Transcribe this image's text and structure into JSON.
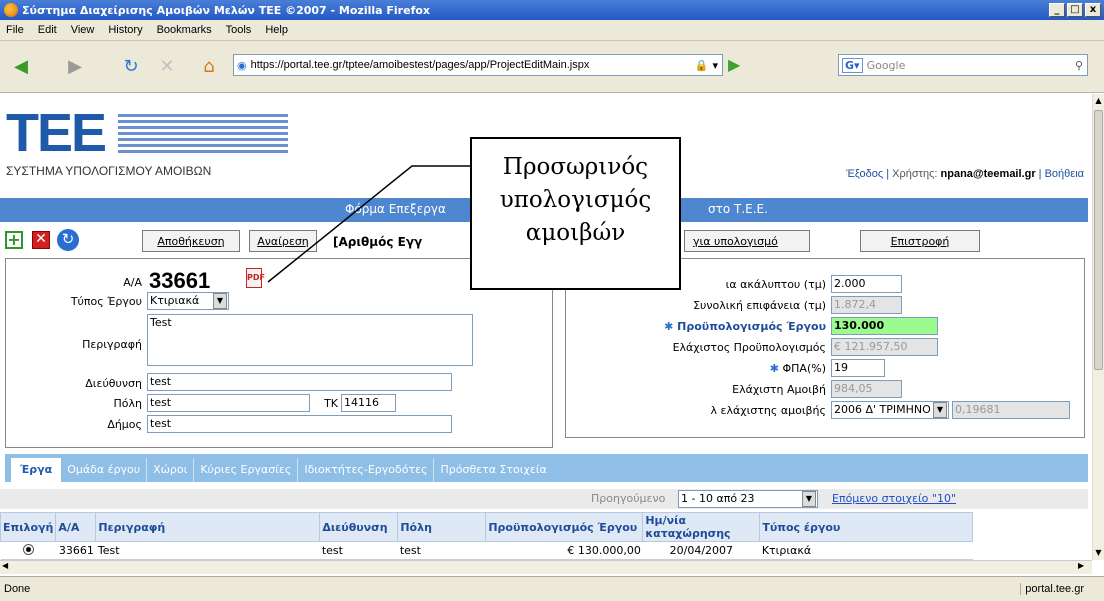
{
  "window": {
    "title": "Σύστημα Διαχείρισης Αμοιβών Μελών ΤΕΕ ©2007 - Mozilla Firefox"
  },
  "menu": [
    "File",
    "Edit",
    "View",
    "History",
    "Bookmarks",
    "Tools",
    "Help"
  ],
  "browser": {
    "url": "https://portal.tee.gr/tptee/amoibestest/pages/app/ProjectEditMain.jspx",
    "search_placeholder": "Google",
    "status": "Done",
    "status_domain": "portal.tee.gr"
  },
  "header": {
    "logo": "ΤΕΕ",
    "system_name": "ΣΥΣΤΗΜΑ ΥΠΟΛΟΓΙΣΜΟΥ ΑΜΟΙΒΩΝ",
    "logout": "Έξοδος",
    "user_label": "Χρήστης:",
    "user": "npana@teemail.gr",
    "help": "Βοήθεια"
  },
  "form": {
    "bar_title_left": "Φόρμα Επεξεργα",
    "bar_title_right": "στο Τ.Ε.Ε.",
    "save": "Αποθήκευση",
    "cancel": "Αναίρεση",
    "record_label": "[Αριθμός Εγγ",
    "calc_button": "για υπολογισμό",
    "back": "Επιστροφή",
    "aa_label": "Α/Α",
    "aa_value": "33661",
    "type_label": "Τύπος Έργου",
    "type_value": "Κτιριακά",
    "desc_label": "Περιγραφή",
    "desc_value": "Test",
    "address_label": "Διεύθυνση",
    "address_value": "test",
    "city_label": "Πόλη",
    "city_value": "test",
    "tk_label": "ΤΚ",
    "tk_value": "14116",
    "municipality_label": "Δήμος",
    "municipality_value": "test",
    "area_label": "ια ακάλυπτου (τμ)",
    "area_value": "2.000",
    "total_area_label": "Συνολική επιφάνεια (τμ)",
    "total_area_value": "1.872,4",
    "budget_label": "Προϋπολογισμός Έργου",
    "budget_value": "130.000",
    "min_budget_label": "Ελάχιστος Προϋπολογισμός",
    "min_budget_value": "€ 121.957,50",
    "vat_label": "ΦΠΑ(%)",
    "vat_value": "19",
    "min_fee_label": "Ελάχιστη Αμοιβή",
    "min_fee_value": "984,05",
    "lambda_label": "λ ελάχιστης αμοιβής",
    "lambda_period": "2006 Δ' ΤΡΙΜΗΝΟ",
    "lambda_value": "0,19681"
  },
  "tabs": [
    "Έργα",
    "Ομάδα έργου",
    "Χώροι",
    "Κύριες Εργασίες",
    "Ιδιοκτήτες-Εργοδότες",
    "Πρόσθετα Στοιχεία"
  ],
  "pager": {
    "previous": "Προηγούμενο",
    "range": "1 - 10 από 23",
    "next": "Επόμενο στοιχείο \"10\""
  },
  "table": {
    "headers": [
      "Επιλογή",
      "Α/Α",
      "Περιγραφή",
      "Διεύθυνση",
      "Πόλη",
      "Προϋπολογισμός Έργου",
      "Ημ/νία καταχώρησης",
      "Τύπος έργου"
    ],
    "rows": [
      {
        "aa": "33661",
        "desc": "Test",
        "address": "test",
        "city": "test",
        "budget": "€ 130.000,00",
        "date": "20/04/2007",
        "type": "Κτιριακά"
      }
    ]
  },
  "callout": {
    "line1": "Προσωρινός",
    "line2": "υπολογισμός",
    "line3": "αμοιβών"
  },
  "colors": {
    "accent": "#4f86d0",
    "highlight": "#9cfb8e",
    "brand": "#1e5aa8"
  }
}
